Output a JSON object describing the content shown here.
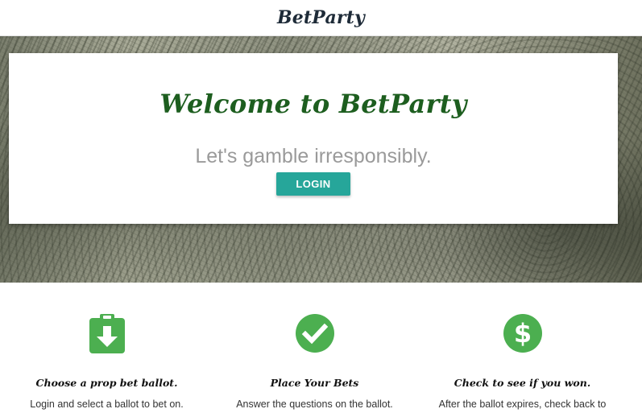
{
  "header": {
    "brand": "BetParty"
  },
  "hero": {
    "title": "Welcome to BetParty",
    "tagline": "Let's gamble irresponsibly.",
    "login_label": "LOGIN"
  },
  "features": [
    {
      "icon": "clipboard-download-icon",
      "title": "Choose a prop bet ballot.",
      "description": "Login and select a ballot to bet on."
    },
    {
      "icon": "check-circle-icon",
      "title": "Place Your Bets",
      "description": "Answer the questions on the ballot."
    },
    {
      "icon": "dollar-circle-icon",
      "title": "Check to see if you won.",
      "description": "After the ballot expires, check back to"
    }
  ],
  "colors": {
    "brand_dark": "#1e2b38",
    "title_green": "#1d5e1f",
    "button_teal": "#26a69a",
    "icon_green": "#4caf50"
  }
}
